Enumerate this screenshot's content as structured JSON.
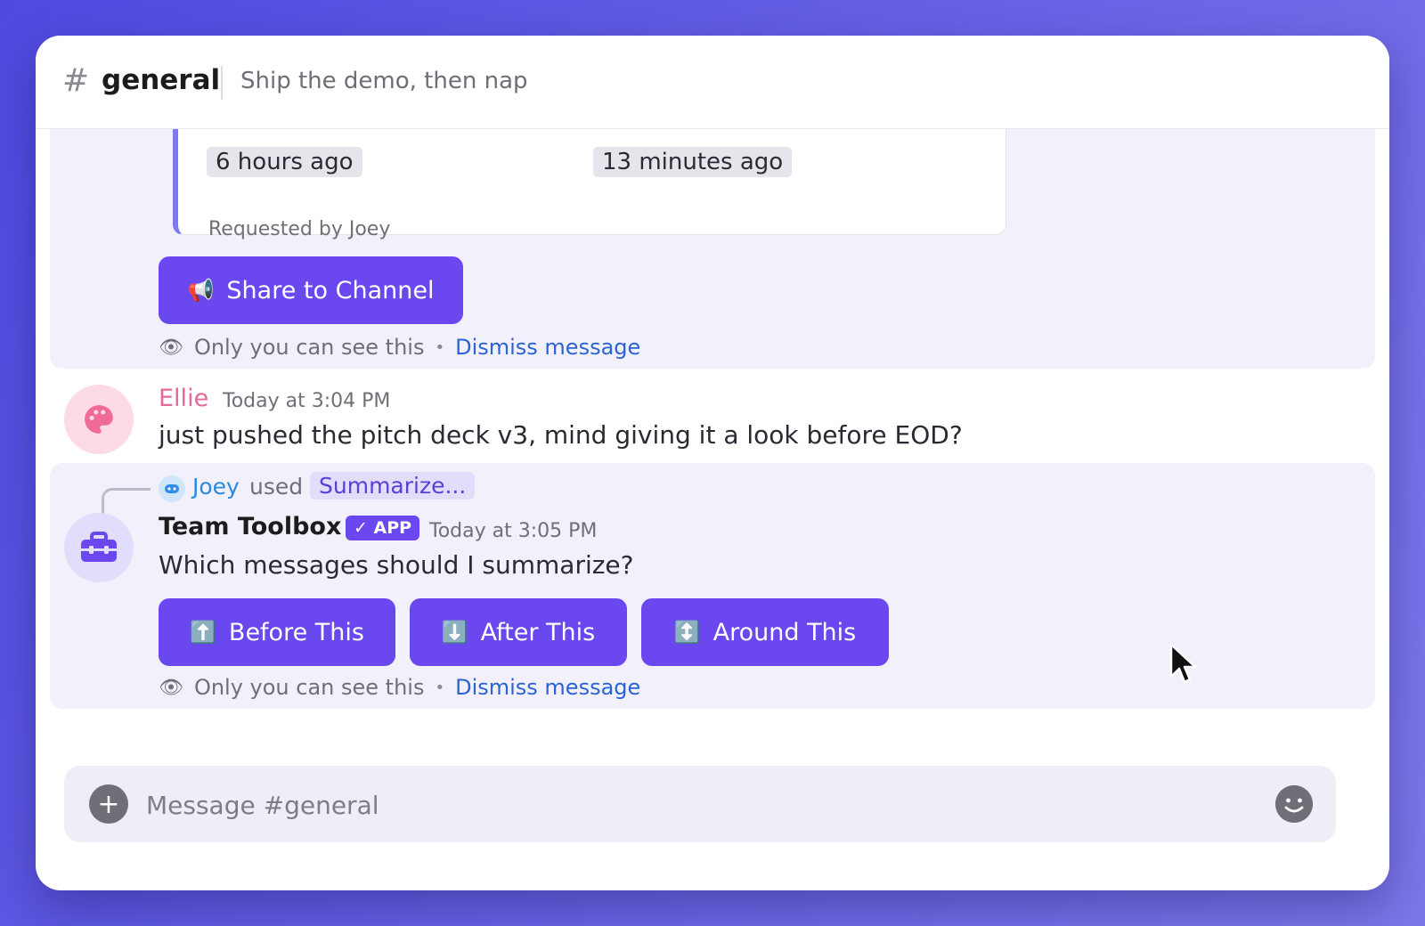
{
  "channel": {
    "hash": "#",
    "name": "general",
    "topic": "Ship the demo, then nap"
  },
  "ephemeral_card": {
    "first_time": "6 hours ago",
    "last_time": "13 minutes ago",
    "requested_by": "Requested by Joey",
    "share_button": {
      "icon": "📢",
      "label": "Share to Channel"
    },
    "visibility_note": "Only you can see this",
    "dismiss_label": "Dismiss message"
  },
  "message_ellie": {
    "sender": "Ellie",
    "timestamp": "Today at 3:04 PM",
    "text": "just pushed the pitch deck v3, mind giving it a look before EOD?",
    "avatar_icon": "palette-icon",
    "sender_color": "#e5689a"
  },
  "message_toolbox": {
    "invoker": "Joey",
    "used_label": "used",
    "command": "Summarize...",
    "sender": "Team Toolbox",
    "badge": "✓ APP",
    "timestamp": "Today at 3:05 PM",
    "text": "Which messages should I summarize?",
    "avatar_icon": "toolbox-icon",
    "buttons": [
      {
        "icon": "⬆️",
        "label": "Before This"
      },
      {
        "icon": "⬇️",
        "label": "After This"
      },
      {
        "icon": "↕️",
        "label": "Around This"
      }
    ],
    "visibility_note": "Only you can see this",
    "dismiss_label": "Dismiss message"
  },
  "composer": {
    "placeholder": "Message #general",
    "plus_icon": "plus-icon",
    "emoji_icon": "emoji-icon"
  },
  "colors": {
    "accent": "#6a47ef",
    "link": "#2a63d4",
    "ephemeral_bg": "#f2f1fb"
  }
}
